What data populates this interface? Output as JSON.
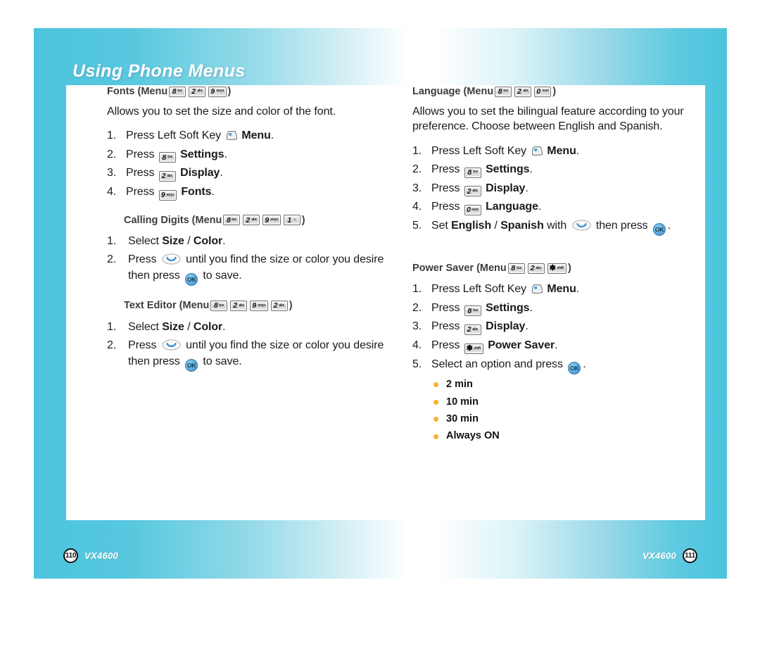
{
  "document": {
    "header_title": "Using Phone Menus"
  },
  "footer": {
    "left": {
      "page": "110",
      "model": "VX4600"
    },
    "right": {
      "page": "111",
      "model": "VX4600"
    }
  },
  "colors": {
    "cyan": "#4cc4dd",
    "bullet_orange": "#fbb033",
    "ok_blue": "#5ba9dd",
    "heading_gray": "#3d3d3d"
  },
  "keys": {
    "k8": {
      "digit": "8",
      "letters": "tuv"
    },
    "k2": {
      "digit": "2",
      "letters": "abc"
    },
    "k9": {
      "digit": "9",
      "letters": "wxyz"
    },
    "k1": {
      "digit": "1",
      "letters": "☺"
    },
    "k0": {
      "digit": "0",
      "letters": "next"
    },
    "kstar": {
      "digit": "✽",
      "letters": "shift"
    },
    "ok_label": "OK"
  },
  "icons": {
    "soft_key": "left-soft-key-icon",
    "nav_key": "navigation-key-icon",
    "ok_key": "ok-key-icon"
  },
  "left_column": {
    "fonts": {
      "title": "Fonts (Menu",
      "title_close": ")",
      "description": "Allows you to set the size and color of the font.",
      "steps": [
        {
          "num": "1.",
          "pre": "Press Left Soft Key ",
          "icon": "softkey",
          "bold": "Menu",
          "post": "."
        },
        {
          "num": "2.",
          "pre": "Press ",
          "icon": "key8",
          "bold": "Settings",
          "post": "."
        },
        {
          "num": "3.",
          "pre": "Press ",
          "icon": "key2",
          "bold": "Display",
          "post": "."
        },
        {
          "num": "4.",
          "pre": "Press ",
          "icon": "key9",
          "bold": "Fonts",
          "post": "."
        }
      ]
    },
    "calling_digits": {
      "title": "Calling Digits (Menu",
      "title_close": ")",
      "step1_num": "1.",
      "step1_pre": "Select ",
      "step1_b1": "Size",
      "step1_mid": " / ",
      "step1_b2": "Color",
      "step1_post": ".",
      "step2_num": "2.",
      "step2_pre": "Press ",
      "step2_mid": " until you find the size or color you desire then press ",
      "step2_post": " to save."
    },
    "text_editor": {
      "title": "Text Editor (Menu",
      "title_close": ")",
      "step1_num": "1.",
      "step1_pre": "Select ",
      "step1_b1": "Size",
      "step1_mid": " / ",
      "step1_b2": "Color",
      "step1_post": ".",
      "step2_num": "2.",
      "step2_pre": "Press ",
      "step2_mid": " until you find the size or color you desire then press ",
      "step2_post": " to save."
    }
  },
  "right_column": {
    "language": {
      "title": "Language (Menu",
      "title_close": ")",
      "description": "Allows you to set the bilingual feature according to your preference. Choose between English and Spanish.",
      "steps": [
        {
          "num": "1.",
          "pre": "Press Left Soft Key ",
          "bold": "Menu",
          "post": "."
        },
        {
          "num": "2.",
          "pre": "Press ",
          "bold": "Settings",
          "post": "."
        },
        {
          "num": "3.",
          "pre": "Press ",
          "bold": "Display",
          "post": "."
        },
        {
          "num": "4.",
          "pre": "Press ",
          "bold": "Language",
          "post": "."
        }
      ],
      "step5_num": "5.",
      "step5_pre": "Set ",
      "step5_b1": "English",
      "step5_mid1": " / ",
      "step5_b2": "Spanish",
      "step5_mid2": " with ",
      "step5_mid3": " then press ",
      "step5_post": "."
    },
    "power_saver": {
      "title": "Power Saver (Menu",
      "title_close": ")",
      "steps": [
        {
          "num": "1.",
          "pre": "Press Left Soft Key ",
          "bold": "Menu",
          "post": "."
        },
        {
          "num": "2.",
          "pre": "Press ",
          "bold": "Settings",
          "post": "."
        },
        {
          "num": "3.",
          "pre": "Press ",
          "bold": "Display",
          "post": "."
        },
        {
          "num": "4.",
          "pre": "Press ",
          "bold": "Power Saver",
          "post": "."
        }
      ],
      "step5_num": "5.",
      "step5_pre": "Select an option and press ",
      "step5_post": ".",
      "options": [
        "2 min",
        "10 min",
        "30 min",
        "Always ON"
      ]
    }
  }
}
